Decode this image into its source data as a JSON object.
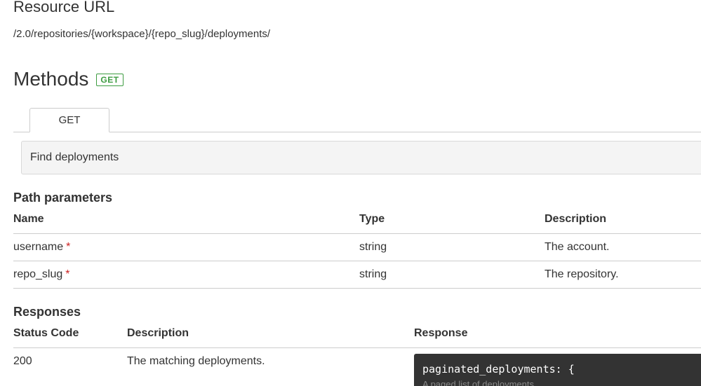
{
  "resource": {
    "title": "Resource URL",
    "url": "/2.0/repositories/{workspace}/{repo_slug}/deployments/"
  },
  "methods": {
    "title": "Methods",
    "badge": "GET",
    "tabs": [
      {
        "label": "GET"
      }
    ]
  },
  "summary": "Find deployments",
  "path_parameters": {
    "heading": "Path parameters",
    "columns": [
      "Name",
      "Type",
      "Description"
    ],
    "rows": [
      {
        "name": "username",
        "required": "*",
        "type": "string",
        "description": "The account."
      },
      {
        "name": "repo_slug",
        "required": "*",
        "type": "string",
        "description": "The repository."
      }
    ]
  },
  "responses": {
    "heading": "Responses",
    "columns": [
      "Status Code",
      "Description",
      "Response"
    ],
    "rows": [
      {
        "status": "200",
        "description": "The matching deployments.",
        "response_code": "paginated_deployments: {",
        "response_comment": "A paged list of deployments"
      }
    ]
  },
  "colors": {
    "badge_green": "#3d9c41",
    "required_red": "#cc2222",
    "code_background": "#333333"
  }
}
